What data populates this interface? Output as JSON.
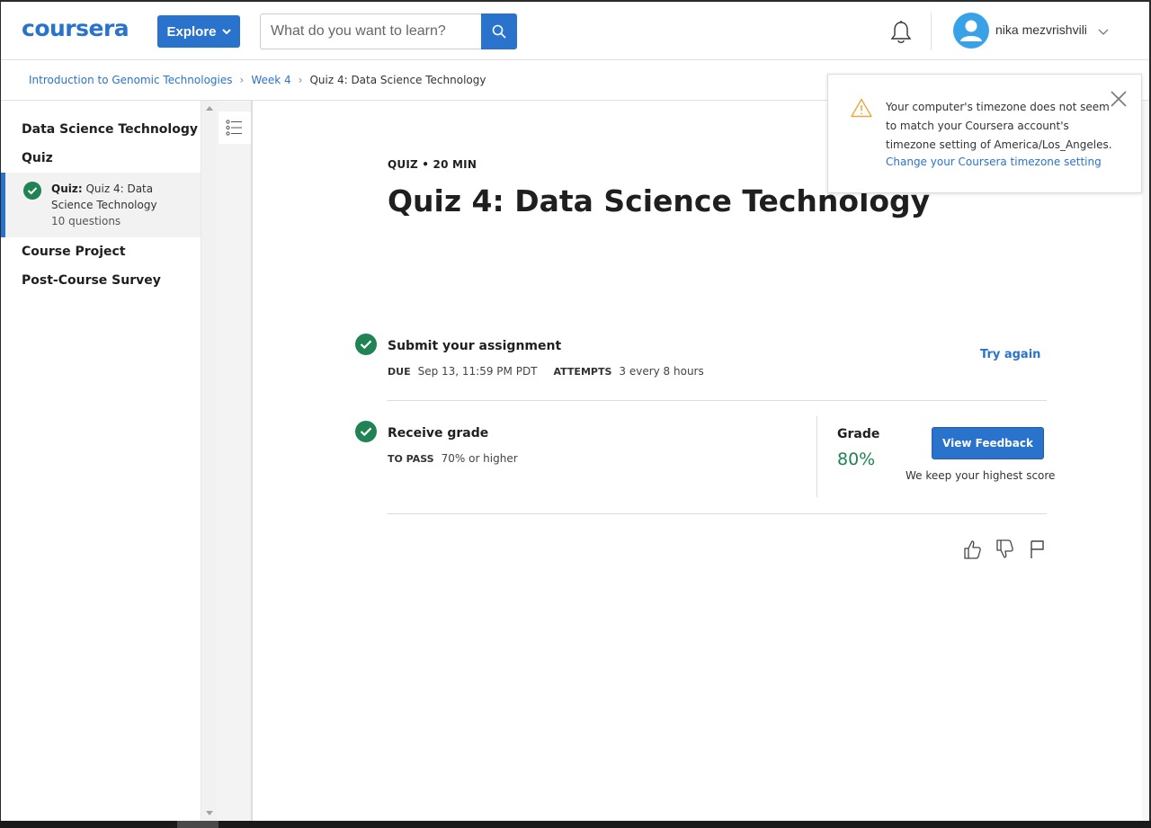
{
  "header": {
    "logo": "coursera",
    "explore_label": "Explore",
    "search_placeholder": "What do you want to learn?",
    "username": "nika mezvrishvili"
  },
  "breadcrumb": {
    "items": [
      "Introduction to Genomic Technologies",
      "Week 4"
    ],
    "current": "Quiz 4: Data Science Technology"
  },
  "sidebar": {
    "section_1": "Data Science Technology",
    "section_2": "Quiz",
    "active_item": {
      "prefix": "Quiz:",
      "title": "Quiz 4: Data Science Technology",
      "sub": "10 questions"
    },
    "section_3": "Course Project",
    "section_4": "Post-Course Survey"
  },
  "main": {
    "meta": "QUIZ • 20 MIN",
    "title": "Quiz 4: Data Science Technology",
    "submit": {
      "title": "Submit your assignment",
      "due_label": "DUE",
      "due_value": "Sep 13, 11:59 PM PDT",
      "attempts_label": "ATTEMPTS",
      "attempts_value": "3 every 8 hours",
      "action": "Try again"
    },
    "receive": {
      "title": "Receive grade",
      "pass_label": "TO PASS",
      "pass_value": "70% or higher",
      "grade_label": "Grade",
      "grade_value": "80%",
      "button": "View Feedback",
      "note": "We keep your highest score"
    }
  },
  "toast": {
    "text": "Your computer's timezone does not seem to match your Coursera account's timezone setting of America/Los_Angeles.",
    "link": "Change your Coursera timezone setting"
  },
  "colors": {
    "brand": "#2a73cc",
    "success": "#1f8354",
    "warning": "#f0a63a"
  }
}
